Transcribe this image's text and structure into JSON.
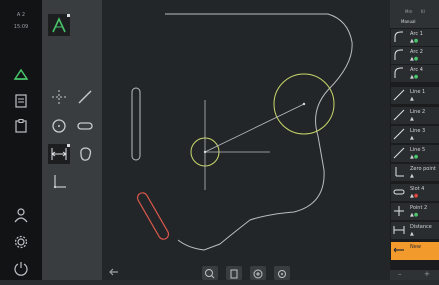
{
  "status": {
    "line1": "A 2",
    "time": "15:09"
  },
  "palette": {
    "accent": "#f39a2c",
    "ok": "#49c46a",
    "warn": "#e0443a",
    "sketch": "#b9bdc0",
    "highlight": "#c8d86a",
    "slot_sel": "#d9574a"
  },
  "tools": {
    "top_tool": "angle-arrow-icon",
    "items": [
      "point-line-icon",
      "line-icon",
      "circle-icon",
      "slot-icon",
      "distance-icon",
      "blob-icon",
      "coordinate-axes-icon"
    ]
  },
  "right_panel": {
    "tabs": [
      "Mm",
      "Manual",
      "Kl"
    ],
    "items": [
      {
        "label": "Arc 1",
        "icon": "arc-icon"
      },
      {
        "label": "Arc 2",
        "icon": "arc-icon"
      },
      {
        "label": "Arc 4",
        "icon": "arc-icon"
      },
      {
        "label": "Line 1",
        "icon": "line-icon"
      },
      {
        "label": "Line 2",
        "icon": "line-icon"
      },
      {
        "label": "Line 3",
        "icon": "line-icon"
      },
      {
        "label": "Line 5",
        "icon": "line-icon"
      },
      {
        "label": "Zero point",
        "icon": "zero-point-icon"
      },
      {
        "label": "Slot 4",
        "icon": "slot-icon"
      },
      {
        "label": "Point 2",
        "icon": "point-icon"
      },
      {
        "label": "Distance",
        "icon": "distance-icon"
      },
      {
        "label": "New",
        "icon": "new-feature-icon"
      }
    ]
  },
  "bottom": {
    "back": "back-arrow-icon",
    "buttons": [
      "zoom-fit-icon",
      "pan-icon",
      "zoom-in-icon",
      "settings-icon"
    ]
  }
}
